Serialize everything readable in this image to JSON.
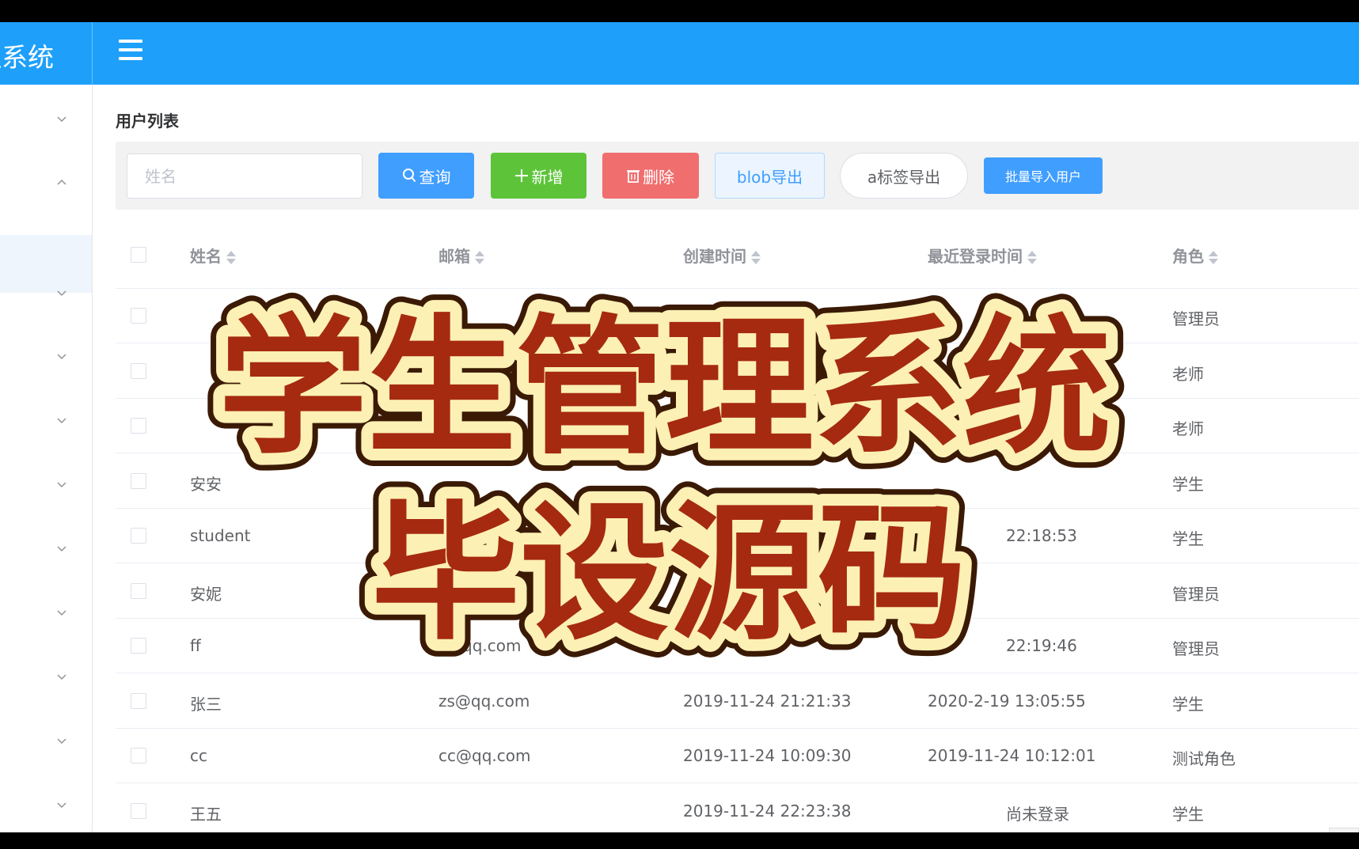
{
  "header": {
    "app_title": "理系统",
    "menu_icon": "hamburger-icon",
    "bg_color": "#1ea0fa"
  },
  "sidebar": {
    "expanded_index": 1
  },
  "page": {
    "title": "用户列表"
  },
  "toolbar": {
    "search_placeholder": "姓名",
    "query_label": "查询",
    "add_label": "新增",
    "delete_label": "删除",
    "blob_export_label": "blob导出",
    "atag_export_label": "a标签导出",
    "batch_import_label": "批量导入用户"
  },
  "table": {
    "columns": [
      "姓名",
      "邮箱",
      "创建时间",
      "最近登录时间",
      "角色"
    ],
    "rows": [
      {
        "name": "",
        "email": "",
        "created": "",
        "last_login": "",
        "role": "管理员"
      },
      {
        "name": "",
        "email": "",
        "created": "",
        "last_login": "",
        "role": "老师"
      },
      {
        "name": "",
        "email": "",
        "created": "",
        "last_login": "",
        "role": "老师"
      },
      {
        "name": "安安",
        "email": "",
        "created": "",
        "last_login": "",
        "role": "学生"
      },
      {
        "name": "student",
        "email": "",
        "created": "",
        "last_login": "22:18:53",
        "role": "学生"
      },
      {
        "name": "安妮",
        "email": "",
        "created": "",
        "last_login": "",
        "role": "管理员"
      },
      {
        "name": "ff",
        "email": "@qq.com",
        "created": "",
        "last_login": "22:19:46",
        "role": "管理员"
      },
      {
        "name": "张三",
        "email": "zs@qq.com",
        "created": "2019-11-24 21:21:33",
        "last_login": "2020-2-19 13:05:55",
        "role": "学生"
      },
      {
        "name": "cc",
        "email": "cc@qq.com",
        "created": "2019-11-24 10:09:30",
        "last_login": "2019-11-24 10:12:01",
        "role": "测试角色"
      },
      {
        "name": "王五",
        "email": "",
        "created": "2019-11-24 22:23:38",
        "last_login": "尚未登录",
        "role": "学生"
      }
    ]
  },
  "overlay": {
    "line1": "学生管理系统",
    "line2": "毕设源码",
    "fill_color": "#a52a10",
    "outline_color": "#fdf0b4"
  }
}
